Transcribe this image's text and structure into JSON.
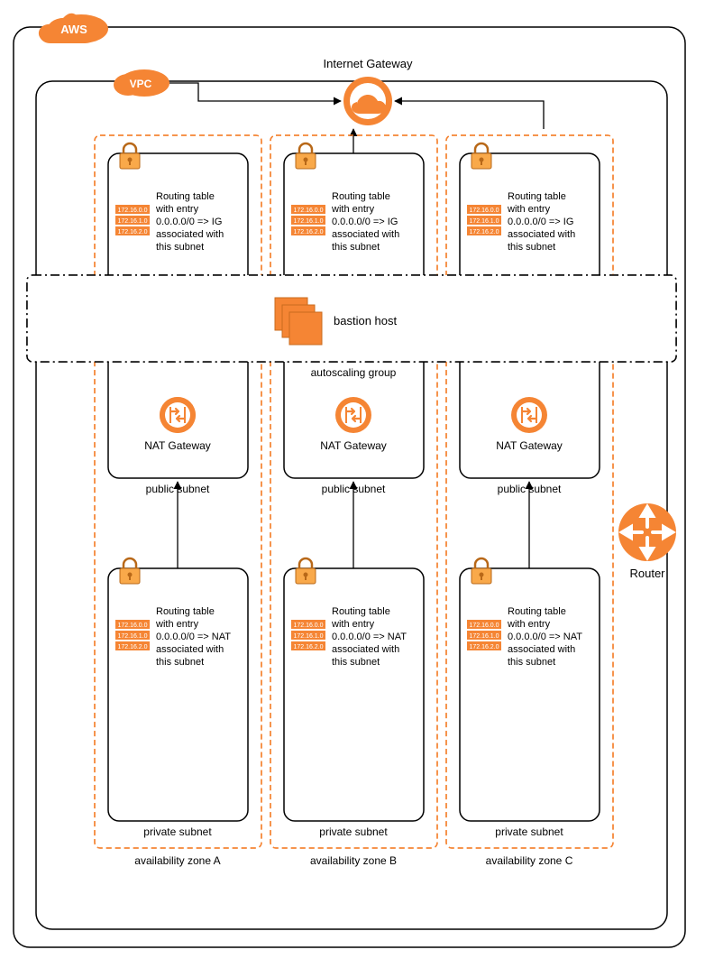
{
  "labels": {
    "aws": "AWS",
    "vpc": "VPC",
    "internetGateway": "Internet Gateway",
    "bastionHost": "bastion host",
    "autoscalingGroup": "autoscaling group",
    "natGateway": "NAT Gateway",
    "publicSubnet": "public subnet",
    "privateSubnet": "private subnet",
    "router": "Router"
  },
  "routingTablePublic": {
    "line1": "Routing table",
    "line2": "with entry",
    "line3": "0.0.0.0/0 => IG",
    "line4": "associated with",
    "line5": "this subnet"
  },
  "routingTablePrivate": {
    "line1": "Routing table",
    "line2": "with entry",
    "line3": "0.0.0.0/0 => NAT",
    "line4": "associated with",
    "line5": "this subnet"
  },
  "cidrs": {
    "a": "172.16.0.0",
    "b": "172.16.1.0",
    "c": "172.16.2.0"
  },
  "azLabels": {
    "a": "availability zone A",
    "b": "availability zone B",
    "c": "availability zone C"
  },
  "colors": {
    "orange": "#F58534",
    "orangeFill": "#F58534",
    "black": "#000000"
  }
}
